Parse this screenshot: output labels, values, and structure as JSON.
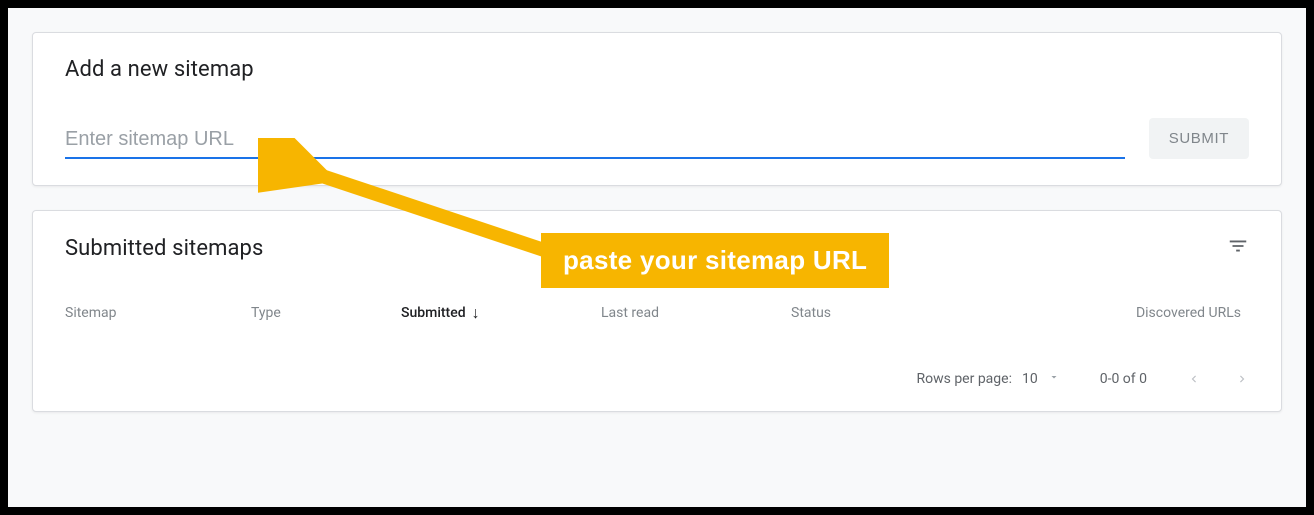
{
  "add_card": {
    "title": "Add a new sitemap",
    "placeholder": "Enter sitemap URL",
    "submit_label": "SUBMIT"
  },
  "submitted_card": {
    "title": "Submitted sitemaps",
    "columns": {
      "sitemap": "Sitemap",
      "type": "Type",
      "submitted": "Submitted",
      "last_read": "Last read",
      "status": "Status",
      "discovered": "Discovered URLs"
    }
  },
  "pager": {
    "rows_label": "Rows per page:",
    "rows_value": "10",
    "range": "0-0 of 0"
  },
  "annotation": {
    "text": "paste your sitemap URL"
  }
}
